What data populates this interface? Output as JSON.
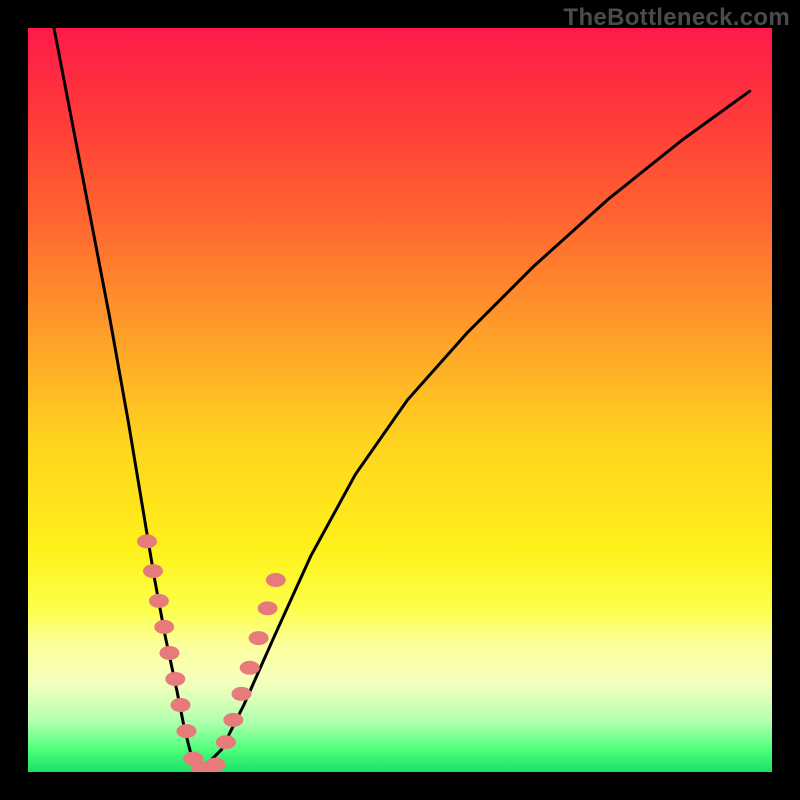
{
  "watermark": "TheBottleneck.com",
  "gradient_stops": [
    {
      "offset": 0.0,
      "color": "#ff1a49"
    },
    {
      "offset": 0.12,
      "color": "#ff3a3a"
    },
    {
      "offset": 0.25,
      "color": "#ff6330"
    },
    {
      "offset": 0.4,
      "color": "#ff9a2a"
    },
    {
      "offset": 0.55,
      "color": "#ffd21f"
    },
    {
      "offset": 0.7,
      "color": "#fff11a"
    },
    {
      "offset": 0.78,
      "color": "#fcff4a"
    },
    {
      "offset": 0.83,
      "color": "#fcff9c"
    },
    {
      "offset": 0.88,
      "color": "#f4ffbe"
    },
    {
      "offset": 0.93,
      "color": "#b6ffb0"
    },
    {
      "offset": 0.97,
      "color": "#4fff7a"
    },
    {
      "offset": 1.0,
      "color": "#19e06a"
    }
  ],
  "curve_style": {
    "stroke": "#000000",
    "stroke_width": 3
  },
  "marker_style": {
    "fill": "#e77a7a",
    "rx": 10,
    "ry": 7
  },
  "chart_data": {
    "type": "line",
    "title": "",
    "xlabel": "",
    "ylabel": "",
    "xlim": [
      0,
      1
    ],
    "ylim": [
      0,
      1
    ],
    "note": "V-shaped bottleneck curve; y is mismatch (0 at valley floor, 1 at top). Valley minimum near x≈0.23. Left branch rises steeply to top-left corner; right branch rises more gradually toward upper-right. Pink markers cluster along both branches in the lower third and across the flat valley floor.",
    "series": [
      {
        "name": "left_branch",
        "x": [
          0.035,
          0.06,
          0.085,
          0.11,
          0.135,
          0.155,
          0.17,
          0.185,
          0.2,
          0.21,
          0.22,
          0.23
        ],
        "y": [
          1.0,
          0.87,
          0.74,
          0.61,
          0.47,
          0.35,
          0.26,
          0.18,
          0.11,
          0.06,
          0.02,
          0.0
        ]
      },
      {
        "name": "right_branch",
        "x": [
          0.23,
          0.26,
          0.29,
          0.33,
          0.38,
          0.44,
          0.51,
          0.59,
          0.68,
          0.78,
          0.88,
          0.97
        ],
        "y": [
          0.0,
          0.03,
          0.09,
          0.18,
          0.29,
          0.4,
          0.5,
          0.59,
          0.68,
          0.77,
          0.85,
          0.915
        ]
      }
    ],
    "markers": {
      "name": "highlighted_points",
      "x": [
        0.16,
        0.168,
        0.176,
        0.183,
        0.19,
        0.198,
        0.205,
        0.213,
        0.222,
        0.232,
        0.242,
        0.252,
        0.266,
        0.276,
        0.287,
        0.298,
        0.31,
        0.322,
        0.333
      ],
      "y": [
        0.31,
        0.27,
        0.23,
        0.195,
        0.16,
        0.125,
        0.09,
        0.055,
        0.018,
        0.005,
        0.005,
        0.01,
        0.04,
        0.07,
        0.105,
        0.14,
        0.18,
        0.22,
        0.258
      ]
    }
  }
}
